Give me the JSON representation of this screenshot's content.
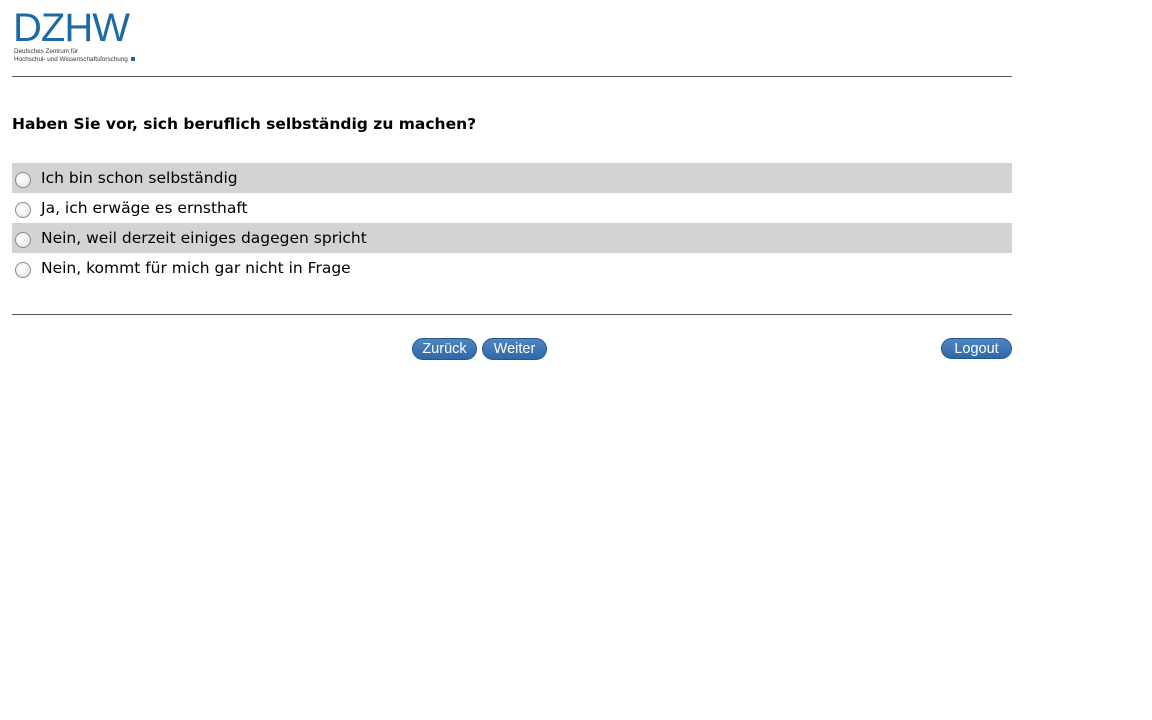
{
  "logo": {
    "wordmark": "DZHW",
    "line1": "Deutsches Zentrum für",
    "line2": "Hochschul- und Wissenschaftsforschung"
  },
  "question": {
    "text": "Haben Sie vor, sich beruflich selbständig zu machen?"
  },
  "options": [
    {
      "label": "Ich bin schon selbständig",
      "selected": false
    },
    {
      "label": "Ja, ich erwäge es ernsthaft",
      "selected": false
    },
    {
      "label": "Nein, weil derzeit einiges dagegen spricht",
      "selected": false
    },
    {
      "label": "Nein, kommt für mich gar nicht in Frage",
      "selected": false
    }
  ],
  "nav": {
    "back_label": "Zurück",
    "next_label": "Weiter",
    "logout_label": "Logout"
  },
  "colors": {
    "brand": "#1d6aa5",
    "button": "#3a72b0",
    "row_shade": "#d3d3d3"
  }
}
